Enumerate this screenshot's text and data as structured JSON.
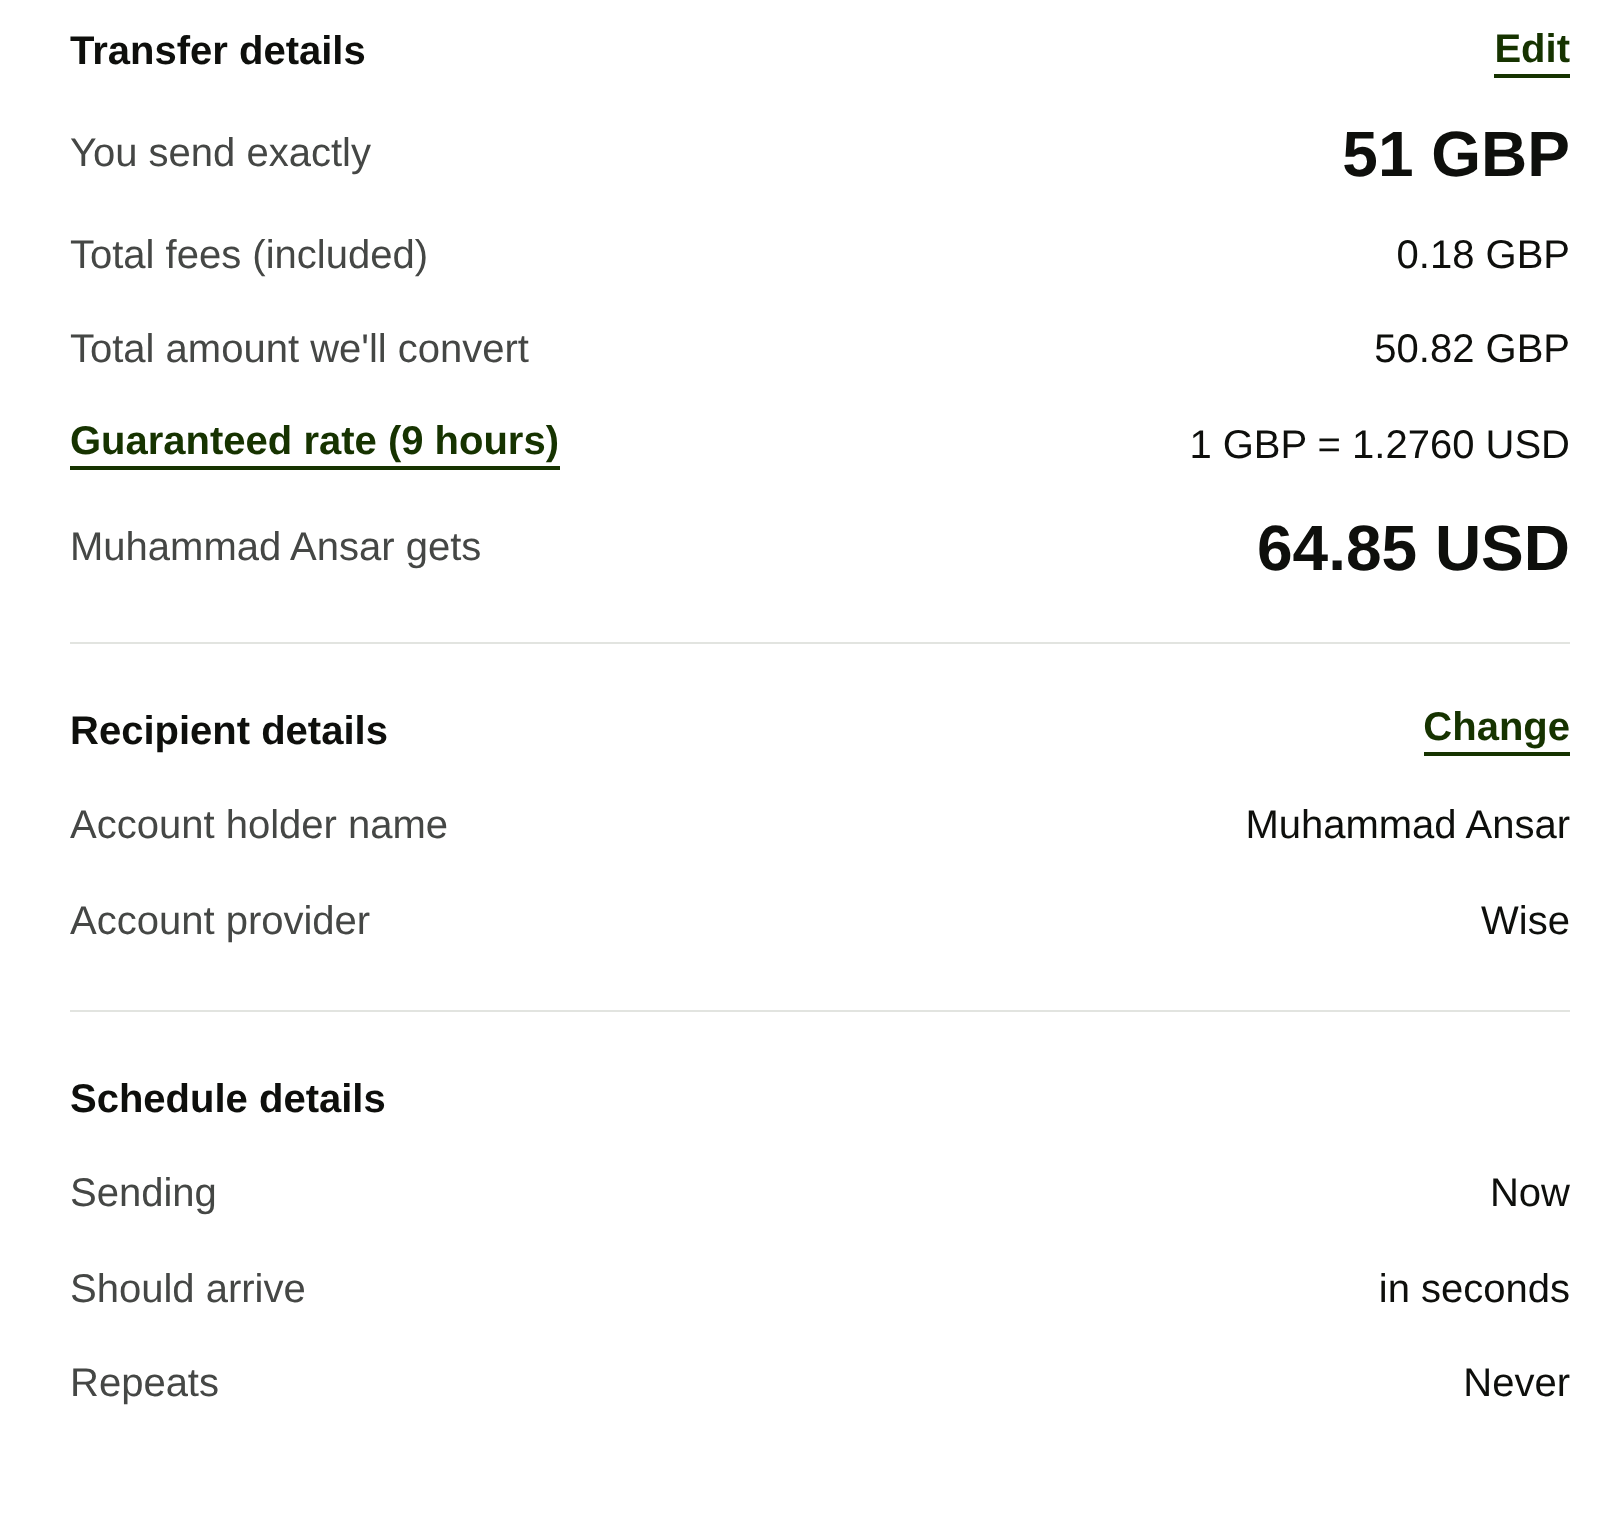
{
  "sections": [
    {
      "title": "Transfer details",
      "action": "Edit",
      "rows": [
        {
          "kind": "large",
          "label": "You send exactly",
          "value": "51 GBP"
        },
        {
          "kind": "plain",
          "label": "Total fees (included)",
          "value": "0.18 GBP"
        },
        {
          "kind": "plain",
          "label": "Total amount we'll convert",
          "value": "50.82 GBP"
        },
        {
          "kind": "link",
          "label": "Guaranteed rate (9 hours)",
          "value": "1 GBP = 1.2760 USD"
        },
        {
          "kind": "large",
          "label": "Muhammad Ansar gets",
          "value": "64.85 USD"
        }
      ]
    },
    {
      "title": "Recipient details",
      "action": "Change",
      "rows": [
        {
          "kind": "plain",
          "label": "Account holder name",
          "value": "Muhammad Ansar"
        },
        {
          "kind": "plain",
          "label": "Account provider",
          "value": "Wise"
        }
      ]
    },
    {
      "title": "Schedule details",
      "rows": [
        {
          "kind": "plain",
          "label": "Sending",
          "value": "Now"
        },
        {
          "kind": "plain",
          "label": "Should arrive",
          "value": "in seconds"
        },
        {
          "kind": "plain",
          "label": "Repeats",
          "value": "Never"
        }
      ]
    }
  ]
}
